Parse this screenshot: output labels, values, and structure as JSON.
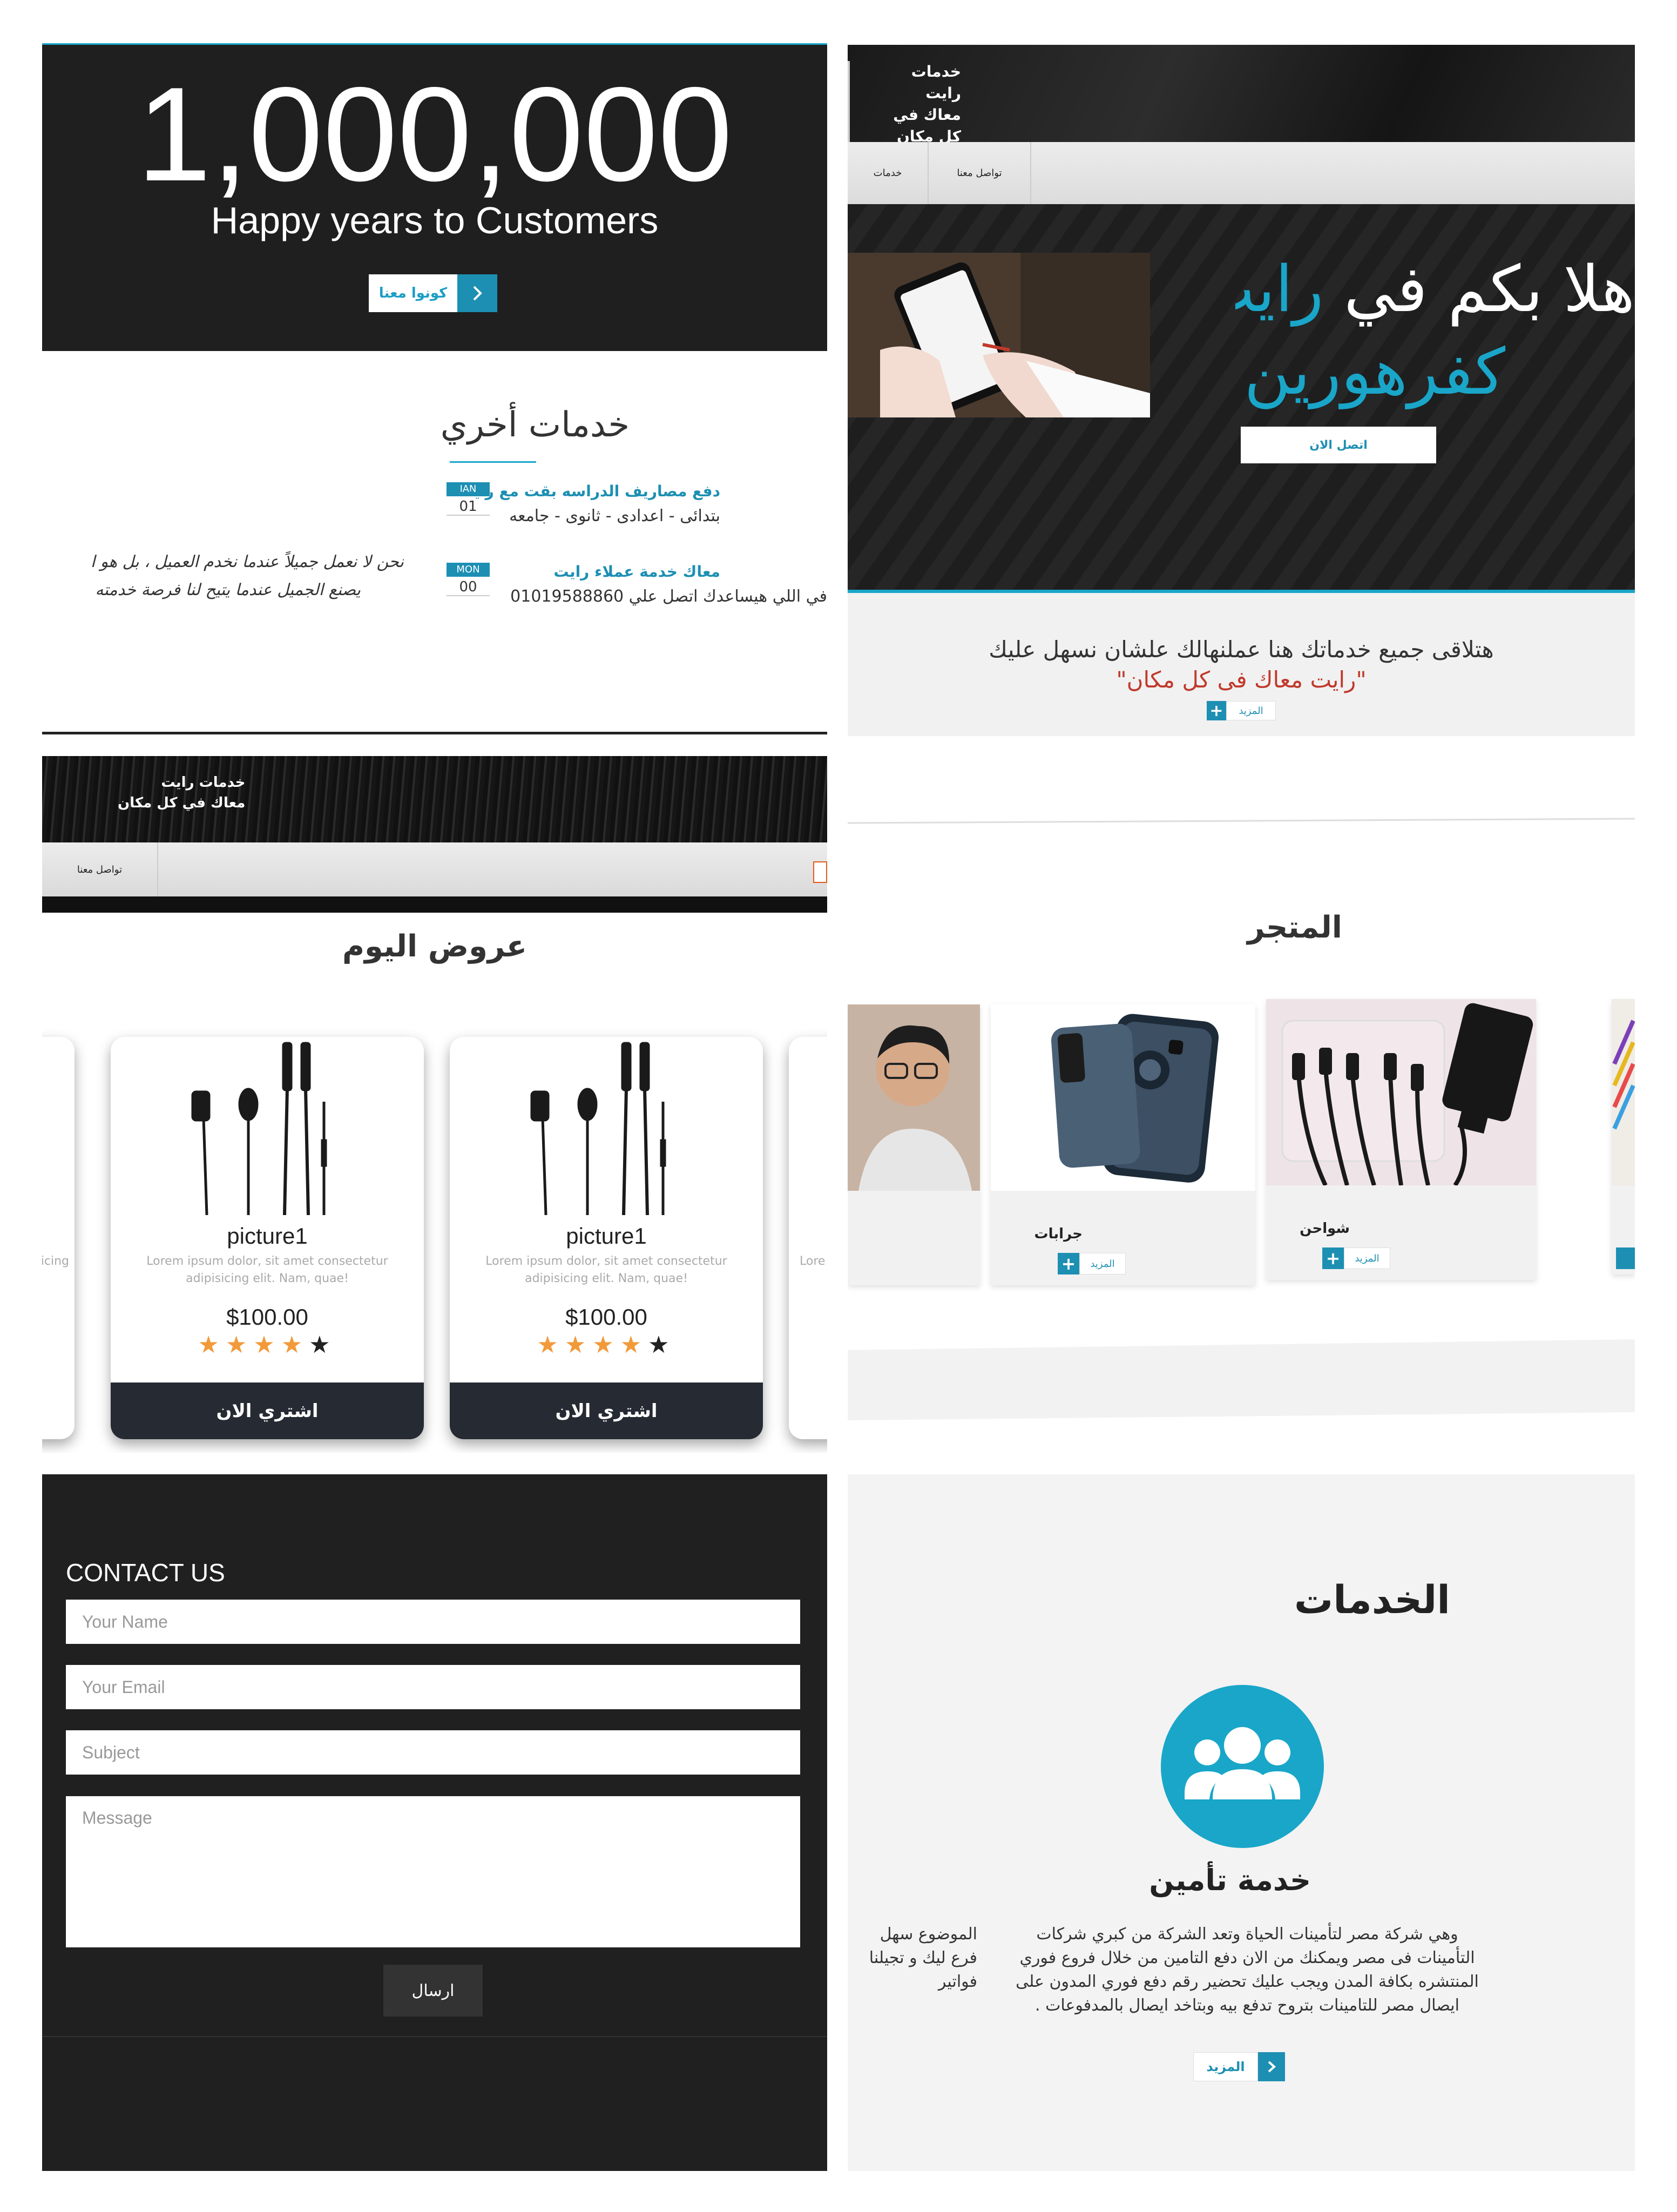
{
  "counter": {
    "number": "1,000,000",
    "subtitle": "Happy years to Customers",
    "button_label": "كونوا معنا",
    "button_icon": "chevron-right-icon"
  },
  "other_services": {
    "title": "خدمات أخري",
    "items": [
      {
        "month": "JAN",
        "day": "01",
        "title": "دفع مصاريف الدراسه بقت مع رايت",
        "text": "بتدائى - اعدادى - ثانوى - جامعه"
      },
      {
        "month": "MON",
        "day": "00",
        "title": "معاك خدمة عملاء رايت",
        "text": "في اللي هيساعدك اتصل علي 01019588860"
      }
    ],
    "quote_line1": "نحن لا نعمل جميلاً عندما نخدم العميل ، بل هو ا",
    "quote_line2": "يصنع الجميل عندما يتيح لنا فرصة خدمته"
  },
  "hero": {
    "brand_line1": "خدمات رايت",
    "brand_line2": "معاك في كل مكان",
    "nav": [
      "خدمات",
      "تواصل معنا"
    ],
    "welcome_white": "هلا بكم في",
    "welcome_blue": "رايت",
    "welcome_line2": "كفرهورين",
    "cta_label": "اتصل الان",
    "tagline": "هتلاقى جميع خدماتك هنا عملنهالك علشان نسهل عليك",
    "slogan": "\"رايت معاك فى كل مكان\"",
    "more_label": "المزيد",
    "accent": "#19a6c9"
  },
  "offers": {
    "brand_line1": "خدمات رايت",
    "brand_line2": "معاك في كل مكان",
    "nav_item": "تواصل معنا",
    "title": "عروض اليوم",
    "edge_text_left": "icing",
    "edge_text_right": "Lore",
    "cards": [
      {
        "name": "picture1",
        "desc": "Lorem ipsum dolor, sit amet consectetur adipisicing elit. Nam, quae!",
        "price": "$100.00",
        "rating": 4,
        "max_rating": 5,
        "buy_label": "اشتري الان"
      },
      {
        "name": "picture1",
        "desc": "Lorem ipsum dolor, sit amet consectetur adipisicing elit. Nam, quae!",
        "price": "$100.00",
        "rating": 4,
        "max_rating": 5,
        "buy_label": "اشتري الان"
      }
    ]
  },
  "store": {
    "title": "المتجر",
    "products": [
      {
        "name": "جرابات",
        "more_label": "المزيد"
      },
      {
        "name": "شواحن",
        "more_label": "المزيد"
      }
    ]
  },
  "contact": {
    "title": "CONTACT US",
    "name_placeholder": "Your Name",
    "email_placeholder": "Your Email",
    "subject_placeholder": "Subject",
    "message_placeholder": "Message",
    "send_label": "ارسال"
  },
  "services": {
    "title": "الخدمات",
    "service_title": "خدمة تأمين",
    "service_text": "وهي شركة مصر لتأمينات الحياة وتعد الشركة من كبري شركات التأمينات فى مصر ويمكنك من الان دفع التامين من خلال فروع فوري المنتشره بكافة المدن ويجب عليك تحضير رقم دفع فوري المدون على ايصال مصر للتامينات بتروح تدفع بيه وبتاخد ايصال بالمدفوعات .",
    "side_line1": "الموضوع سهل",
    "side_line2": "فرع ليك و تجيلنا",
    "side_line3": "فواتير",
    "more_label": "المزيد",
    "icon": "users-group-icon"
  }
}
